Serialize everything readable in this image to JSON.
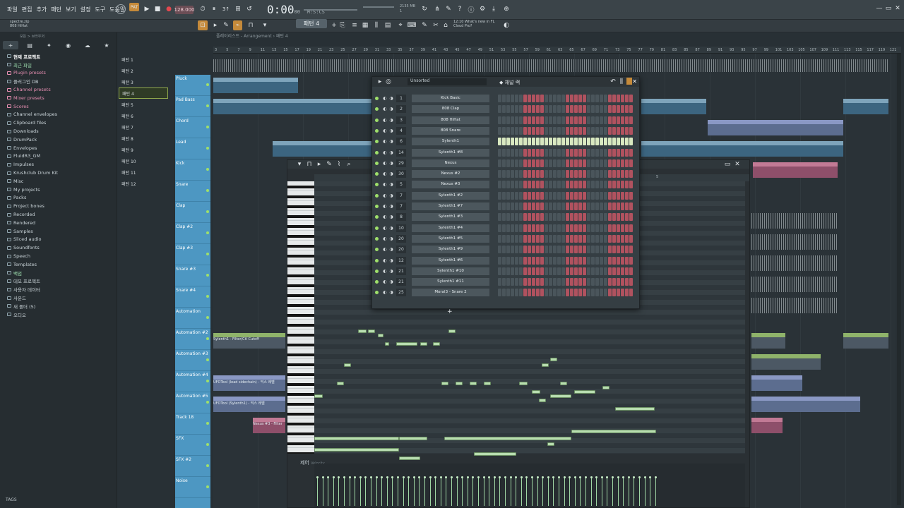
{
  "menu": [
    "파일",
    "편집",
    "추가",
    "패턴",
    "보기",
    "설정",
    "도구",
    "도움말"
  ],
  "transport": {
    "bpm": "128.000",
    "time": "0:00",
    "time_sub": "00",
    "time_mark": "M:S:CS",
    "pattern": "패턴 4"
  },
  "cpu": {
    "mem": "2135 MB",
    "cpu": "1"
  },
  "news": {
    "line1": "12:10  What's new in FL",
    "line2": "Cloud Pro?"
  },
  "file": {
    "name": "spectre.zip",
    "hint": "808 HiHat"
  },
  "browser": {
    "head": "모든 > 브라우저",
    "items": [
      {
        "label": "현재 프로젝트",
        "style": "bold"
      },
      {
        "label": "최근 파일",
        "style": "green"
      },
      {
        "label": "Plugin presets",
        "style": "pink"
      },
      {
        "label": "플러그인 DB",
        "style": ""
      },
      {
        "label": "Channel presets",
        "style": "pink"
      },
      {
        "label": "Mixer presets",
        "style": "pink"
      },
      {
        "label": "Scores",
        "style": "pink"
      },
      {
        "label": "Channel envelopes",
        "style": ""
      },
      {
        "label": "Clipboard files",
        "style": ""
      },
      {
        "label": "Downloads",
        "style": ""
      },
      {
        "label": "DrumPack",
        "style": ""
      },
      {
        "label": "Envelopes",
        "style": ""
      },
      {
        "label": "FluidR3_GM",
        "style": ""
      },
      {
        "label": "Impulses",
        "style": ""
      },
      {
        "label": "Krushclub Drum Kit",
        "style": ""
      },
      {
        "label": "Misc",
        "style": ""
      },
      {
        "label": "My projects",
        "style": ""
      },
      {
        "label": "Packs",
        "style": ""
      },
      {
        "label": "Project bones",
        "style": ""
      },
      {
        "label": "Recorded",
        "style": ""
      },
      {
        "label": "Rendered",
        "style": ""
      },
      {
        "label": "Samples",
        "style": ""
      },
      {
        "label": "Sliced audio",
        "style": ""
      },
      {
        "label": "Soundfonts",
        "style": ""
      },
      {
        "label": "Speech",
        "style": ""
      },
      {
        "label": "Templates",
        "style": ""
      },
      {
        "label": "백업",
        "style": "green"
      },
      {
        "label": "데모 프로젝트",
        "style": ""
      },
      {
        "label": "사용자 데이터",
        "style": ""
      },
      {
        "label": "사운드",
        "style": ""
      },
      {
        "label": "새 폴더 (5)",
        "style": ""
      },
      {
        "label": "오디오",
        "style": ""
      }
    ],
    "tags": "TAGS"
  },
  "playlist": {
    "title": "플레이리스트 - Arrangement › 패턴 4",
    "patterns": [
      "패턴 1",
      "패턴 2",
      "패턴 3",
      "패턴 4",
      "패턴 5",
      "패턴 6",
      "패턴 7",
      "패턴 8",
      "패턴 9",
      "패턴 10",
      "패턴 11",
      "패턴 12"
    ],
    "active_pattern": 3,
    "ruler": [
      "3",
      "5",
      "7",
      "9",
      "11",
      "13",
      "15",
      "17",
      "19",
      "21",
      "23",
      "25",
      "27",
      "29",
      "31",
      "33",
      "35",
      "37",
      "39",
      "41",
      "43",
      "45",
      "47",
      "49",
      "51",
      "53",
      "55",
      "57",
      "59",
      "61",
      "63",
      "65",
      "67",
      "69",
      "71",
      "73",
      "75",
      "77",
      "79",
      "81",
      "83",
      "85",
      "87",
      "89",
      "91",
      "93",
      "95",
      "97",
      "99",
      "101",
      "103",
      "105",
      "107",
      "109",
      "111",
      "113",
      "115",
      "117",
      "119",
      "121"
    ],
    "tracks": [
      "Pluck",
      "Pad Bass",
      "Chord",
      "Lead",
      "Kick",
      "Snare",
      "Clap",
      "Clap #2",
      "Clap #3",
      "Snare #3",
      "Snare #4",
      "Automation",
      "Automation #2",
      "Automation #3",
      "Automation #4",
      "Automation #5",
      "Track 18",
      "SFX",
      "SFX #2",
      "Noise"
    ],
    "clips": {
      "synth_cutoff": "Sylenth1 - Filter/Ctl Cutoff",
      "ufo_lead": "UFOTool (lead sidechain) - 믹스 레벨",
      "ufo_synth": "UFOTool (Sylenth1) - 믹스 레벨",
      "nexus": "Nexus #3 - Filter"
    }
  },
  "rack": {
    "filter": "Unsorted",
    "title": "채널 랙",
    "channels": [
      {
        "num": "1",
        "name": "Kick Basic"
      },
      {
        "num": "2",
        "name": "808 Clap"
      },
      {
        "num": "3",
        "name": "808 HiHat"
      },
      {
        "num": "4",
        "name": "808 Snare"
      },
      {
        "num": "6",
        "name": "Sylenth1"
      },
      {
        "num": "14",
        "name": "Sylenth1 #8"
      },
      {
        "num": "29",
        "name": "Nexus"
      },
      {
        "num": "30",
        "name": "Nexus #2"
      },
      {
        "num": "5",
        "name": "Nexus #3"
      },
      {
        "num": "7",
        "name": "Sylenth1 #2"
      },
      {
        "num": "7",
        "name": "Sylenth1 #7"
      },
      {
        "num": "8",
        "name": "Sylenth1 #3"
      },
      {
        "num": "10",
        "name": "Sylenth1 #4"
      },
      {
        "num": "20",
        "name": "Sylenth1 #5"
      },
      {
        "num": "20",
        "name": "Sylenth1 #9"
      },
      {
        "num": "12",
        "name": "Sylenth1 #6"
      },
      {
        "num": "21",
        "name": "Sylenth1 #10"
      },
      {
        "num": "21",
        "name": "Sylenth1 #11"
      },
      {
        "num": "25",
        "name": "Moral3 - Snare 2"
      }
    ],
    "add": "+"
  },
  "piano_roll": {
    "ruler_mark": "5",
    "vel_label": "제어",
    "vel_sub": "Velocity"
  }
}
